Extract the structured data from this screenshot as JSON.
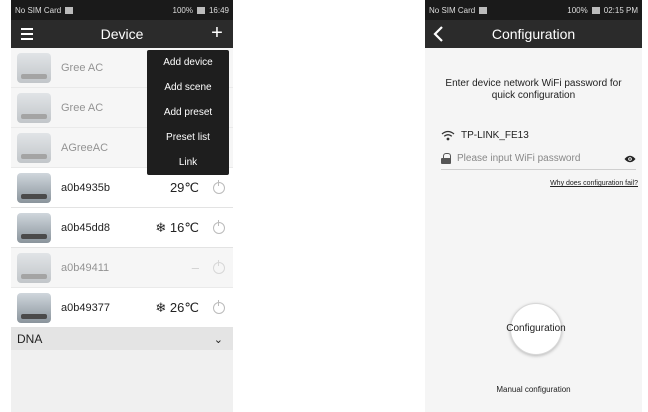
{
  "left_phone": {
    "status_bar": {
      "carrier": "No SIM Card",
      "battery": "100%",
      "time": "16:49"
    },
    "app_bar": {
      "title": "Device",
      "add_symbol": "+"
    },
    "devices": [
      {
        "name": "Gree AC",
        "temp": "",
        "dimmed": true
      },
      {
        "name": "Gree AC",
        "temp": "",
        "dimmed": true
      },
      {
        "name": "AGreeAC",
        "temp": "",
        "dimmed": true
      },
      {
        "name": "a0b4935b",
        "temp": "29℃",
        "dimmed": false
      },
      {
        "name": "a0b45dd8",
        "temp": "❄ 16℃",
        "dimmed": false
      },
      {
        "name": "a0b49411",
        "temp": "–",
        "dimmed": true
      },
      {
        "name": "a0b49377",
        "temp": "❄ 26℃",
        "dimmed": false
      }
    ],
    "group": {
      "label": "DNA",
      "chevron": "⌄"
    },
    "menu": {
      "items": [
        "Add device",
        "Add scene",
        "Add preset",
        "Preset list",
        "Link"
      ]
    }
  },
  "right_phone": {
    "status_bar": {
      "carrier": "No SIM Card",
      "battery": "100%",
      "time": "02:15 PM"
    },
    "app_bar": {
      "title": "Configuration"
    },
    "prompt": "Enter device network WiFi password for quick configuration",
    "ssid": "TP-LINK_FE13",
    "password_placeholder": "Please input WiFi password",
    "help_link": "Why does configuration fail?",
    "config_button": "Configuration",
    "manual_link": "Manual configuration"
  },
  "colors": {
    "app_bar": "#2b2b2b",
    "menu_bg": "#1e1e1e",
    "status_bar": "#1a1a1a"
  },
  "icons": [
    "menu-icon",
    "plus-icon",
    "power-icon",
    "chevron-down-icon",
    "back-icon",
    "wifi-icon",
    "lock-icon",
    "eye-icon"
  ]
}
